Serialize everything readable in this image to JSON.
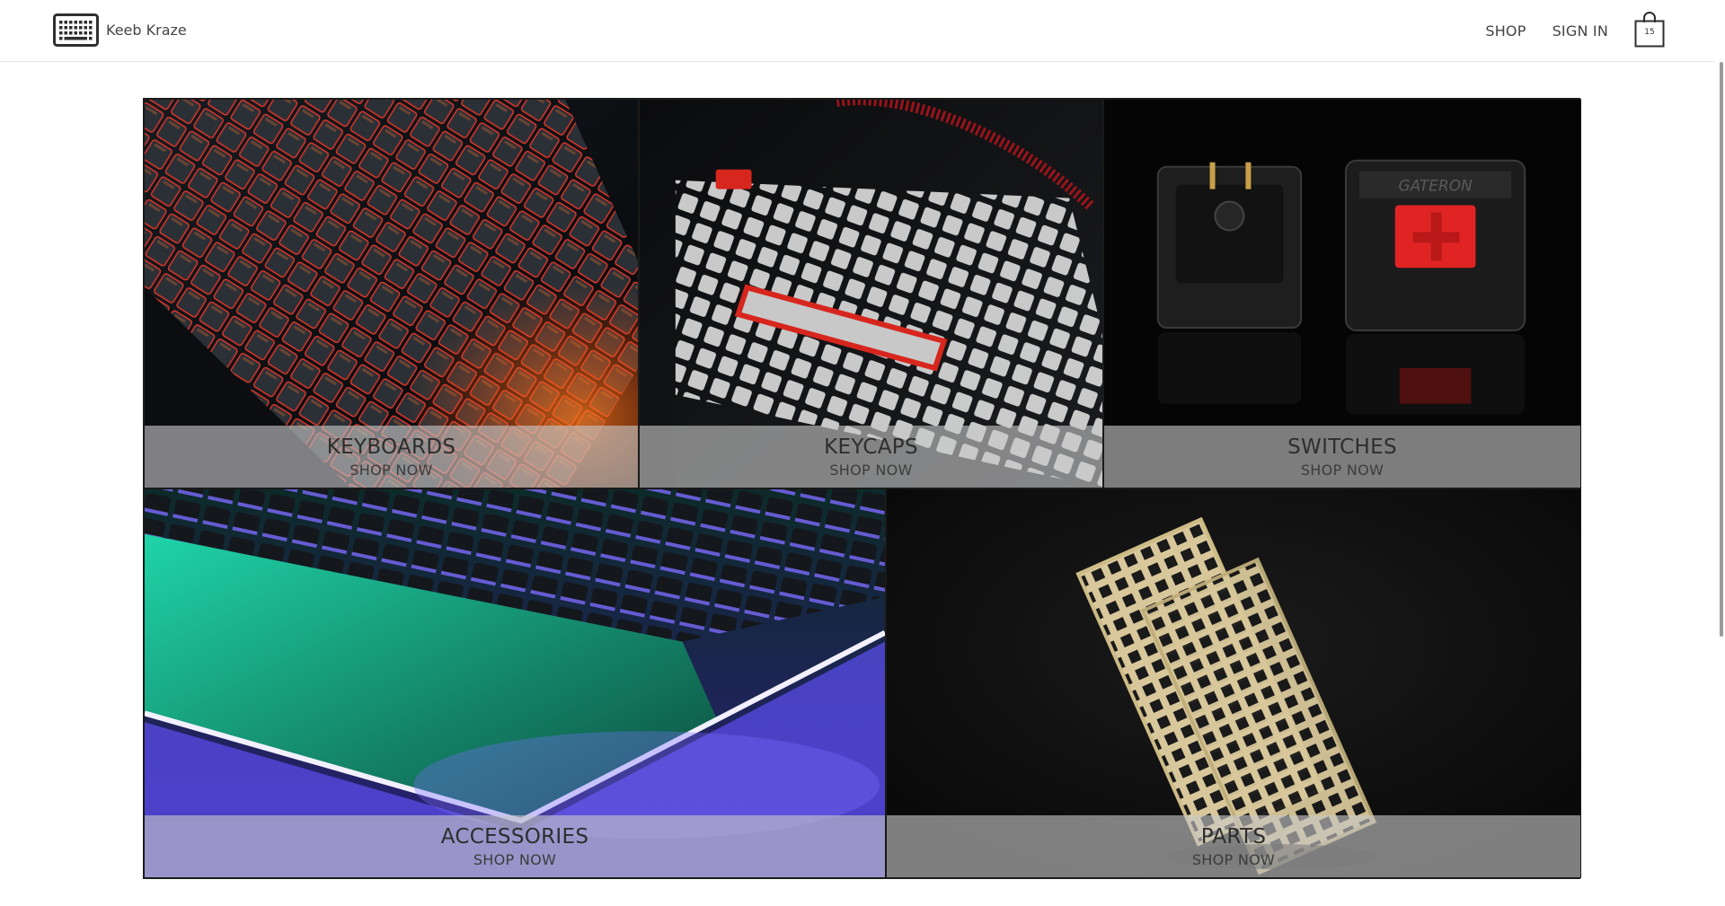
{
  "header": {
    "brand": "Keeb Kraze",
    "logo_icon": "keyboard-icon",
    "nav": {
      "shop_label": "SHOP",
      "signin_label": "SIGN IN"
    },
    "cart": {
      "icon": "shopping-bag-icon",
      "count": "15"
    }
  },
  "categories": [
    {
      "title": "KEYBOARDS",
      "cta": "SHOP NOW"
    },
    {
      "title": "KEYCAPS",
      "cta": "SHOP NOW"
    },
    {
      "title": "SWITCHES",
      "cta": "SHOP NOW"
    },
    {
      "title": "ACCESSORIES",
      "cta": "SHOP NOW"
    },
    {
      "title": "PARTS",
      "cta": "SHOP NOW"
    }
  ],
  "colors": {
    "caption_overlay": "#c8c8c8",
    "keyboard_glow": "#e2362a",
    "keycap_accent": "#d7261e",
    "switch_stem": "#e02424",
    "accessory_teal": "#19c8a0",
    "accessory_violet": "#6a5cff",
    "plate_brass": "#d8c79a"
  }
}
